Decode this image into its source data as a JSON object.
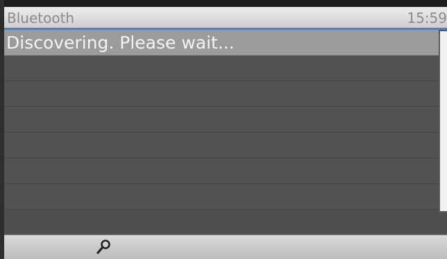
{
  "header": {
    "title": "Bluetooth",
    "time": "15:59"
  },
  "list": {
    "items": [
      {
        "label": "Discovering. Please wait..."
      },
      {
        "label": ""
      },
      {
        "label": ""
      },
      {
        "label": ""
      },
      {
        "label": ""
      },
      {
        "label": ""
      },
      {
        "label": ""
      }
    ],
    "selected_index": 0
  },
  "softkeys": [
    {
      "icon": "search-icon",
      "label": ""
    }
  ],
  "colors": {
    "accent": "#5b7db6",
    "selection": "#9b9b9b",
    "background": "#4f4f4f"
  }
}
